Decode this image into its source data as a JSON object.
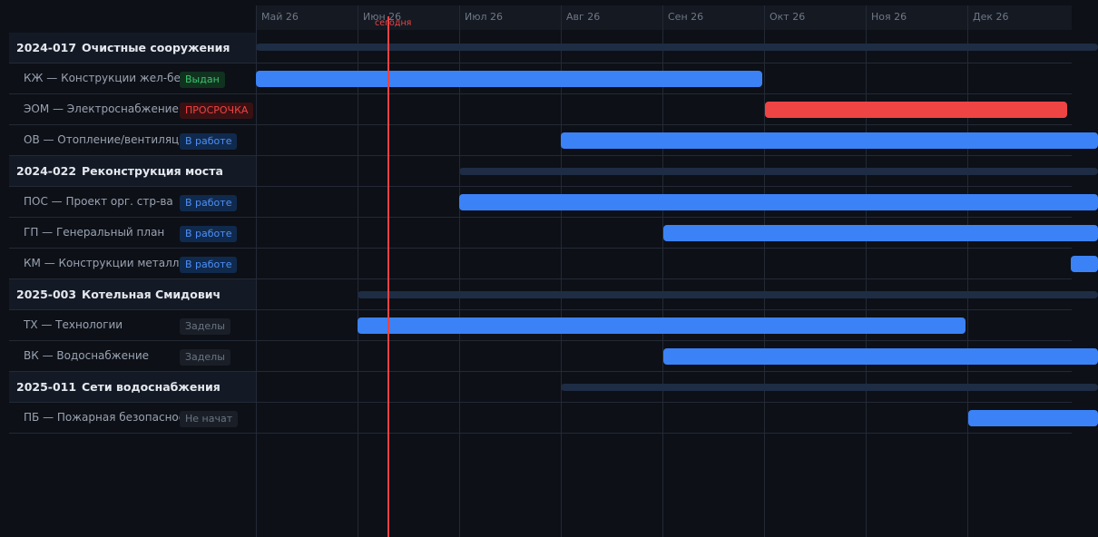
{
  "timeline": {
    "months": [
      "Май 26",
      "Июн 26",
      "Июл 26",
      "Авг 26",
      "Сен 26",
      "Окт 26",
      "Ноя 26",
      "Дек 26"
    ],
    "today_label": "сегодня"
  },
  "projects": [
    {
      "code": "2024-017",
      "name": "Очистные сооружения",
      "sections": [
        {
          "label": "КЖ — Конструкции жел-бет",
          "status": "Выдан"
        },
        {
          "label": "ЭОМ — Электроснабжение",
          "status": "ПРОСРОЧКА"
        },
        {
          "label": "ОВ — Отопление/вентиляция",
          "status": "В работе"
        }
      ]
    },
    {
      "code": "2024-022",
      "name": "Реконструкция моста",
      "sections": [
        {
          "label": "ПОС — Проект орг. стр-ва",
          "status": "В работе"
        },
        {
          "label": "ГП — Генеральный план",
          "status": "В работе"
        },
        {
          "label": "КМ — Конструкции металл.",
          "status": "В работе"
        }
      ]
    },
    {
      "code": "2025-003",
      "name": "Котельная Смидович",
      "sections": [
        {
          "label": "ТХ — Технологии",
          "status": "Заделы"
        },
        {
          "label": "ВК — Водоснабжение",
          "status": "Заделы"
        }
      ]
    },
    {
      "code": "2025-011",
      "name": "Сети водоснабжения",
      "sections": [
        {
          "label": "ПБ — Пожарная безопасность",
          "status": "Не начат"
        }
      ]
    }
  ],
  "colors": {
    "background": "#0d1017",
    "bar_accent": "#3b82f6",
    "overdue": "#ef4444",
    "issued": "#3ec46d",
    "today": "#ef4444"
  }
}
